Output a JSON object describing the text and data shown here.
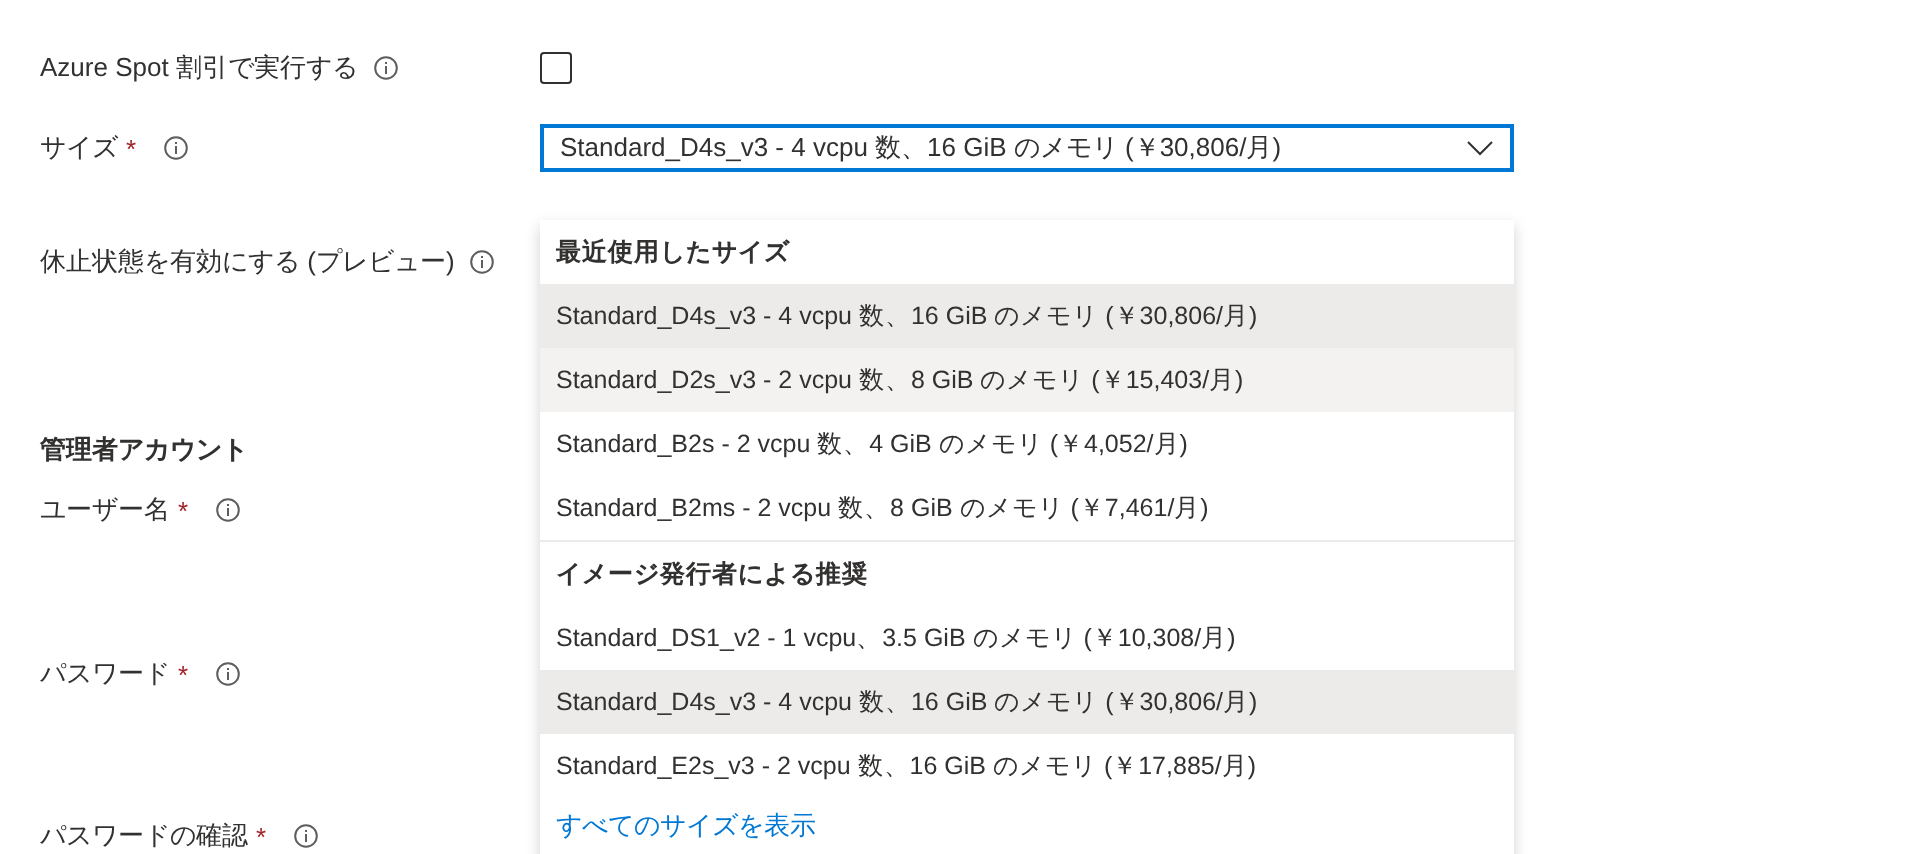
{
  "form": {
    "rows": [
      {
        "kind": "checkbox",
        "label": "Azure Spot 割引で実行する",
        "checked": false
      },
      {
        "kind": "select",
        "label": "サイズ",
        "required_mark": "*",
        "value": "Standard_D4s_v3 - 4 vcpu 数、16 GiB のメモリ (￥30,806/月)"
      },
      {
        "kind": "label",
        "label": "休止状態を有効にする (プレビュー)"
      },
      {
        "kind": "heading",
        "label": "管理者アカウント"
      },
      {
        "kind": "label",
        "label": "ユーザー名",
        "required_mark": "*"
      },
      {
        "kind": "label",
        "label": "パスワード",
        "required_mark": "*"
      },
      {
        "kind": "field",
        "label": "パスワードの確認",
        "required_mark": "*"
      }
    ]
  },
  "dropdown": {
    "groups": [
      {
        "heading": "最近使用したサイズ",
        "items": [
          {
            "text": "Standard_D4s_v3 - 4 vcpu 数、16 GiB のメモリ (￥30,806/月)",
            "selected": true,
            "hovered": false
          },
          {
            "text": "Standard_D2s_v3 - 2 vcpu 数、8 GiB のメモリ (￥15,403/月)",
            "selected": false,
            "hovered": true
          },
          {
            "text": "Standard_B2s - 2 vcpu 数、4 GiB のメモリ (￥4,052/月)",
            "selected": false,
            "hovered": false
          },
          {
            "text": "Standard_B2ms - 2 vcpu 数、8 GiB のメモリ (￥7,461/月)",
            "selected": false,
            "hovered": false
          }
        ]
      },
      {
        "heading": "イメージ発行者による推奨",
        "items": [
          {
            "text": "Standard_DS1_v2 - 1 vcpu、3.5 GiB のメモリ (￥10,308/月)",
            "selected": false,
            "hovered": false
          },
          {
            "text": "Standard_D4s_v3 - 4 vcpu 数、16 GiB のメモリ (￥30,806/月)",
            "selected": true,
            "hovered": false
          },
          {
            "text": "Standard_E2s_v3 - 2 vcpu 数、16 GiB のメモリ (￥17,885/月)",
            "selected": false,
            "hovered": false
          }
        ]
      }
    ],
    "link": "すべてのサイズを表示"
  }
}
